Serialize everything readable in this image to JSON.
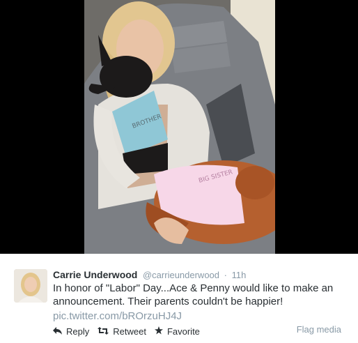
{
  "tweet": {
    "author_name": "Carrie Underwood",
    "author_handle": "@carrieunderwood",
    "separator": "·",
    "time": "11h",
    "text_lines": [
      "In honor of \"Labor\" Day...Ace & Penny would like to make an",
      "announcement. Their parents couldn't be happier!"
    ],
    "link": "pic.twitter.com/bROrzuHJ4J"
  },
  "actions": {
    "reply_label": "Reply",
    "retweet_label": "Retweet",
    "favorite_label": "Favorite",
    "flag_label": "Flag media"
  },
  "icons": {
    "reply": "reply-arrow-icon",
    "retweet": "retweet-icon",
    "favorite": "star-icon"
  },
  "colors": {
    "media_background": "#000000",
    "name_text": "#292f33",
    "meta_text": "#8899a6",
    "shirt_blue": "#8fc7d6",
    "shirt_pink": "#f7d7e8"
  }
}
